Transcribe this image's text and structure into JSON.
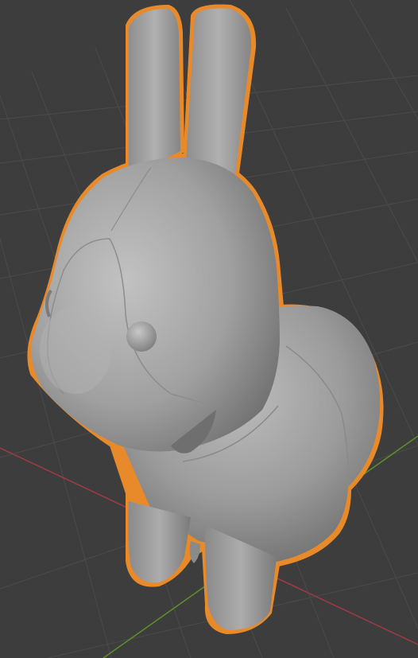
{
  "viewport": {
    "background_color": "#3d3d3d",
    "grid_color": "#4b4b4b",
    "x_axis_color": "#a03a44",
    "y_axis_color": "#5e8f2a",
    "selection_outline_color": "#e88a2a",
    "object_base_color": "#9b9b9b",
    "object_shadow_color": "#6b6b6b",
    "object_highlight_color": "#bdbdbd",
    "selected_object": "bunny-mesh",
    "object_selected": true
  }
}
